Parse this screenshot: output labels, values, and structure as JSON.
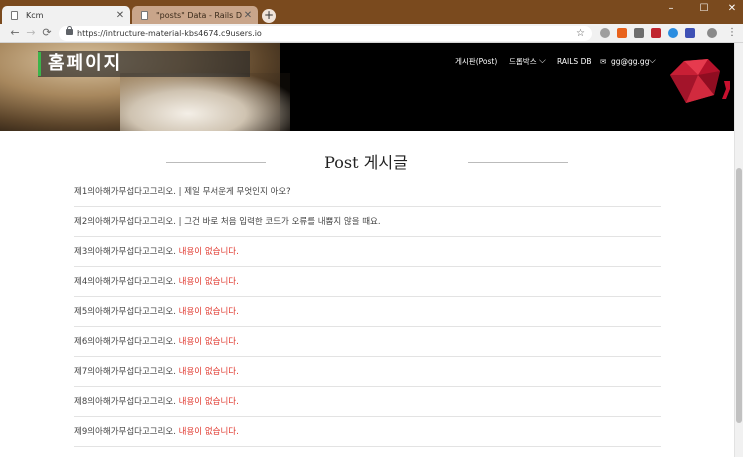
{
  "browser": {
    "tabs": [
      {
        "title": "Kcm",
        "close": "✕"
      },
      {
        "title": "\"posts\" Data - Rails DB",
        "close": "✕"
      }
    ],
    "new_tab": "+",
    "window": {
      "minimize": "–",
      "maximize": "☐",
      "close": "✕"
    },
    "nav": {
      "back": "←",
      "forward": "→",
      "reload": "⟳"
    },
    "url": "https://intructure-material-kbs4674.c9users.io",
    "bookmark": "☆"
  },
  "site": {
    "brand": "홈페이지",
    "nav": {
      "board": "게시판(Post)",
      "dropdown": "드롭박스",
      "rails_db": "RAILS DB",
      "user": "gg@gg.gg",
      "caret": "⌵",
      "user_icon": "✉"
    },
    "heading": "Post 게시글"
  },
  "posts": [
    {
      "title": "제1의아해가무섭다고그리오.",
      "body": "| 제일 무서운게 무엇인지 아오?",
      "empty": false
    },
    {
      "title": "제2의아해가무섭다고그리오.",
      "body": "| 그건 바로 처음 입력한 코드가 오류를 내뿜지 않을 때요.",
      "empty": false
    },
    {
      "title": "제3의아해가무섭다고그리오.",
      "body": "내용이 없습니다.",
      "empty": true
    },
    {
      "title": "제4의아해가무섭다고그리오.",
      "body": "내용이 없습니다.",
      "empty": true
    },
    {
      "title": "제5의아해가무섭다고그리오.",
      "body": "내용이 없습니다.",
      "empty": true
    },
    {
      "title": "제6의아해가무섭다고그리오.",
      "body": "내용이 없습니다.",
      "empty": true
    },
    {
      "title": "제7의아해가무섭다고그리오.",
      "body": "내용이 없습니다.",
      "empty": true
    },
    {
      "title": "제8의아해가무섭다고그리오.",
      "body": "내용이 없습니다.",
      "empty": true
    },
    {
      "title": "제9의아해가무섭다고그리오.",
      "body": "내용이 없습니다.",
      "empty": true
    }
  ],
  "colors": {
    "titlebar": "#7a4a1e",
    "brand_accent": "#3bb54a",
    "empty_text": "#e0362c",
    "ruby": "#c8102e"
  }
}
